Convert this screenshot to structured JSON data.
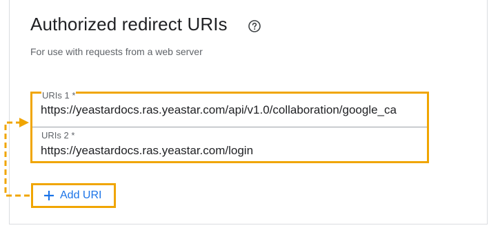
{
  "section": {
    "title": "Authorized redirect URIs",
    "help_icon": "help-circle-icon",
    "subtitle": "For use with requests from a web server"
  },
  "uris": [
    {
      "label": "URIs 1 *",
      "value": "https://yeastardocs.ras.yeastar.com/api/v1.0/collaboration/google_ca"
    },
    {
      "label": "URIs 2 *",
      "value": "https://yeastardocs.ras.yeastar.com/login"
    }
  ],
  "add_button": {
    "label": "Add URI",
    "icon": "plus-icon"
  },
  "colors": {
    "highlight": "#f0a500",
    "link": "#1a73e8",
    "text": "#202124",
    "secondary_text": "#5f6368"
  }
}
